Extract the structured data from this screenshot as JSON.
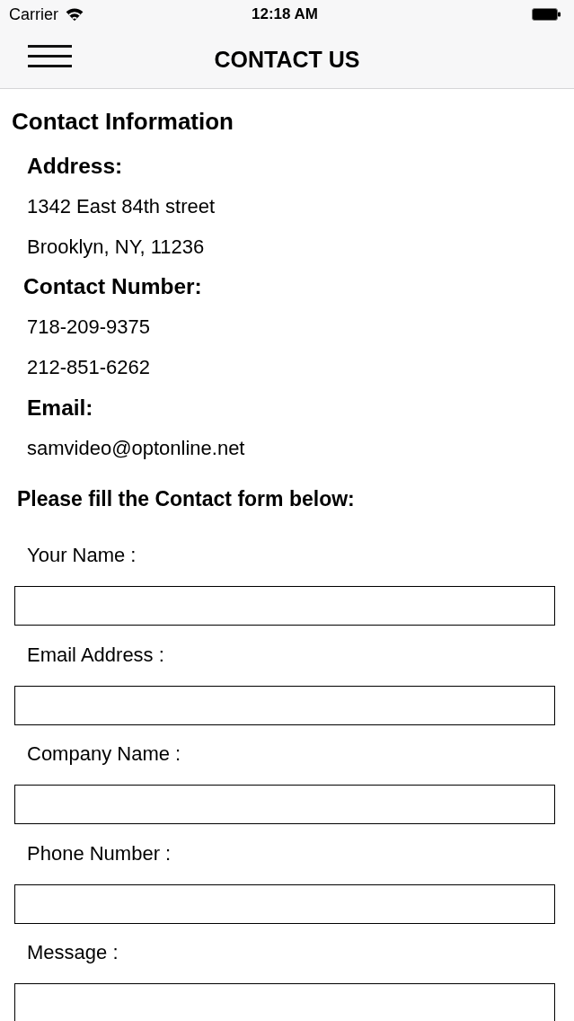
{
  "status_bar": {
    "carrier": "Carrier",
    "time": "12:18 AM"
  },
  "nav_bar": {
    "title": "CONTACT US"
  },
  "contact_info": {
    "title": "Contact Information",
    "sections": [
      {
        "heading": "Address:",
        "lines": [
          "1342 East 84th street",
          "Brooklyn, NY, 11236"
        ]
      },
      {
        "heading": "Contact Number:",
        "lines": [
          "718-209-9375",
          "212-851-6262"
        ]
      },
      {
        "heading": "Email:",
        "lines": [
          "samvideo@optonline.net"
        ]
      }
    ]
  },
  "form": {
    "intro": "Please fill the Contact form below:",
    "fields": [
      {
        "label": "Your Name :"
      },
      {
        "label": "Email Address :"
      },
      {
        "label": "Company Name :"
      },
      {
        "label": "Phone Number :"
      },
      {
        "label": "Message :"
      }
    ]
  }
}
